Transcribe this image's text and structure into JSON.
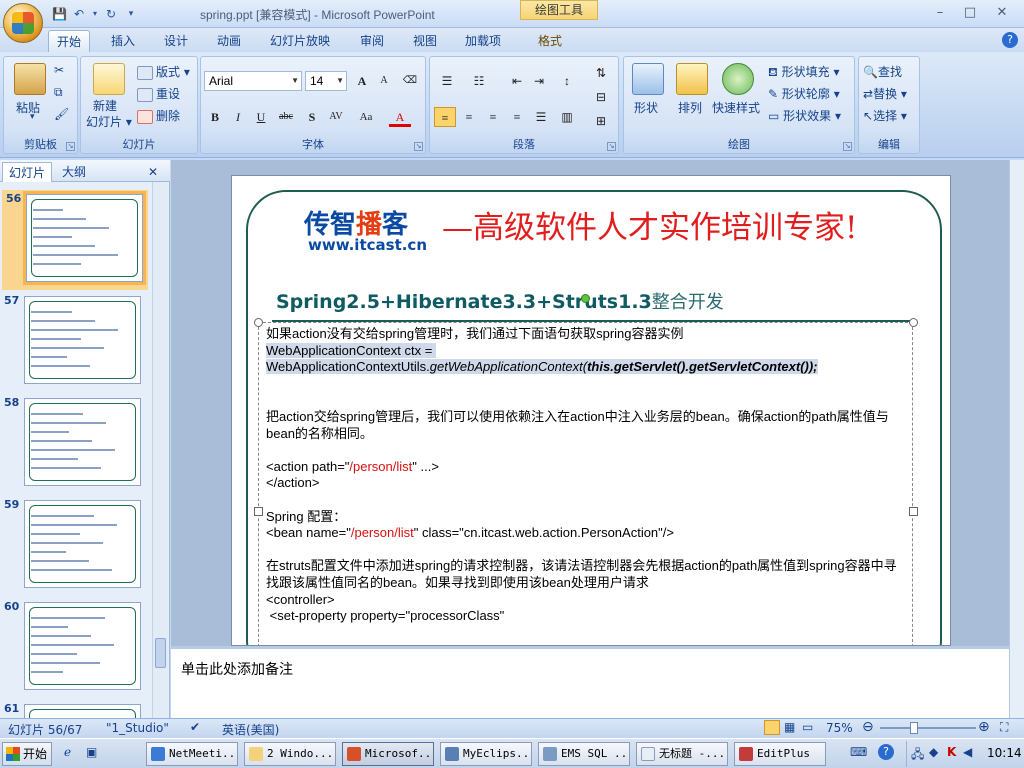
{
  "window": {
    "title": "spring.ppt [兼容模式] - Microsoft PowerPoint",
    "context_tab_title": "绘图工具",
    "minimize": "–",
    "restore": "□",
    "close": "✕",
    "help": "?"
  },
  "ribbon_tabs": [
    "开始",
    "插入",
    "设计",
    "动画",
    "幻灯片放映",
    "审阅",
    "视图",
    "加载项",
    "格式"
  ],
  "groups": {
    "clipboard": {
      "label": "剪贴板",
      "paste": "粘贴"
    },
    "slides": {
      "label": "幻灯片",
      "new_slide_1": "新建",
      "new_slide_2": "幻灯片 ▾",
      "layout": "版式 ▾",
      "reset": "重设",
      "delete": "删除"
    },
    "font": {
      "label": "字体",
      "font_name": "Arial",
      "font_size": "14",
      "grow": "A",
      "shrink": "A",
      "bold": "B",
      "italic": "I",
      "underline": "U",
      "strike": "abc",
      "shadow": "S",
      "spacing": "AV",
      "case": "Aa",
      "color": "A"
    },
    "paragraph": {
      "label": "段落"
    },
    "drawing": {
      "label": "绘图",
      "shapes": "形状",
      "arrange": "排列",
      "quick_styles": "快速样式",
      "fill": "形状填充 ▾",
      "outline": "形状轮廓 ▾",
      "effects": "形状效果 ▾"
    },
    "editing": {
      "label": "编辑",
      "find": "查找",
      "replace": "替换 ▾",
      "select": "选择 ▾"
    }
  },
  "left_panel": {
    "tab_slides": "幻灯片",
    "tab_outline": "大纲",
    "close": "✕",
    "thumbnails": [
      {
        "num": "56",
        "selected": true
      },
      {
        "num": "57",
        "selected": false
      },
      {
        "num": "58",
        "selected": false
      },
      {
        "num": "59",
        "selected": false
      },
      {
        "num": "60",
        "selected": false
      },
      {
        "num": "61",
        "selected": false
      }
    ]
  },
  "slide": {
    "logo_left": "传智",
    "logo_mid": "播",
    "logo_right": "客",
    "logo_url": "www.itcast.cn",
    "slogan": "—高级软件人才实作培训专家!",
    "title": "Spring2.5+Hibernate3.3+Struts1.3",
    "title_cn": "整合开发",
    "lines": {
      "l1": "如果action没有交给spring管理时，我们通过下面语句获取spring容器实例",
      "l2": "WebApplicationContext ctx = ",
      "l3a": "WebApplicationContextUtils.",
      "l3b": "getWebApplicationContext(",
      "l3c": "this.getServlet().getServletContext());",
      "l4": "把action交给spring管理后，我们可以使用依赖注入在action中注入业务层的bean。确保action的path属性值与bean的名称相同。",
      "l5a": "<action path=\"",
      "l5b": "/person/list",
      "l5c": "\" ...>",
      "l6": "</action>",
      "l7": "Spring 配置：",
      "l8a": "<bean name=\"",
      "l8b": "/person/list",
      "l8c": "\" class=\"cn.itcast.web.action.PersonAction\"/>",
      "l9": "在struts配置文件中添加进spring的请求控制器，该请法语控制器会先根据action的path属性值到spring容器中寻找跟该属性值同名的bean。如果寻找到即使用该bean处理用户请求",
      "l10": "<controller>",
      "l11": " <set-property property=\"processorClass\""
    }
  },
  "notes_placeholder": "单击此处添加备注",
  "status": {
    "slide_pos": "幻灯片 56/67",
    "theme": "\"1_Studio\"",
    "language": "英语(美国)",
    "zoom": "75%"
  },
  "taskbar": {
    "start": "开始",
    "items": [
      "NetMeeti...",
      "2 Windo...",
      "Microsof...",
      "MyEclips...",
      "EMS SQL ...",
      "无标题 -...",
      "EditPlus"
    ],
    "clock": "10:14"
  },
  "colors": {
    "accent": "#15428b",
    "logo_blue": "#0b4aa3",
    "logo_red": "#e53d12",
    "slogan_red": "#e21d1d",
    "title_teal": "#0f5a63"
  }
}
